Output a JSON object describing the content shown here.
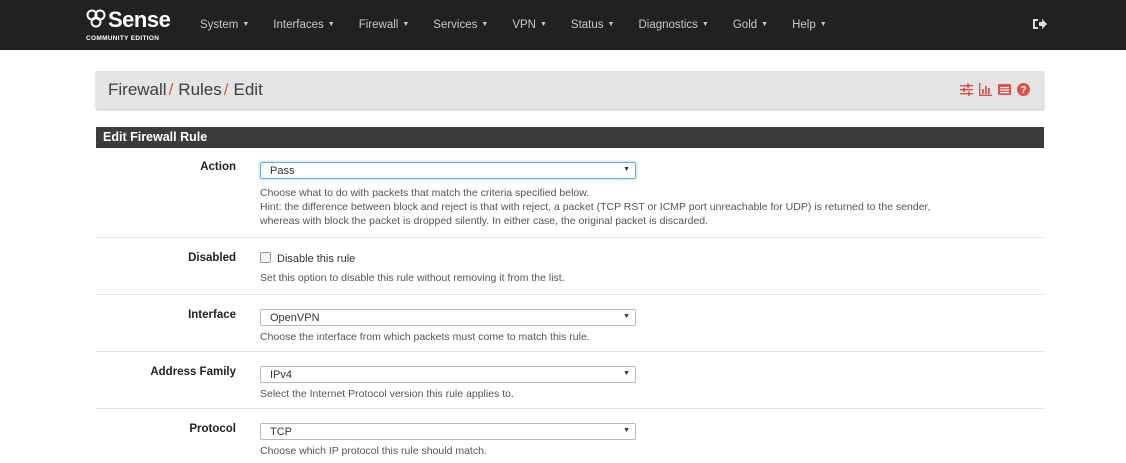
{
  "brand": {
    "name": "Sense",
    "edition": "COMMUNITY EDITION"
  },
  "nav": {
    "items": [
      "System",
      "Interfaces",
      "Firewall",
      "Services",
      "VPN",
      "Status",
      "Diagnostics",
      "Gold",
      "Help"
    ]
  },
  "breadcrumb": {
    "part1": "Firewall",
    "part2": "Rules",
    "part3": "Edit"
  },
  "header_icons": [
    "sliders-icon",
    "bar-chart-icon",
    "list-icon",
    "help-circle-icon"
  ],
  "colors": {
    "navbar": "#212121",
    "accent_red": "#d9534f",
    "header_bar": "#e4e4e4",
    "panel_heading": "#3c3c3c"
  },
  "panel": {
    "title": "Edit Firewall Rule",
    "action": {
      "label": "Action",
      "value": "Pass",
      "help1": "Choose what to do with packets that match the criteria specified below.",
      "help2": "Hint: the difference between block and reject is that with reject, a packet (TCP RST or ICMP port unreachable for UDP) is returned to the sender,",
      "help3": "whereas with block the packet is dropped silently. In either case, the original packet is discarded."
    },
    "disabled": {
      "label": "Disabled",
      "checkbox_label": "Disable this rule",
      "checked": false,
      "help": "Set this option to disable this rule without removing it from the list."
    },
    "interface": {
      "label": "Interface",
      "value": "OpenVPN",
      "help": "Choose the interface from which packets must come to match this rule."
    },
    "address_family": {
      "label": "Address Family",
      "value": "IPv4",
      "help": "Select the Internet Protocol version this rule applies to."
    },
    "protocol": {
      "label": "Protocol",
      "value": "TCP",
      "help": "Choose which IP protocol this rule should match."
    }
  }
}
